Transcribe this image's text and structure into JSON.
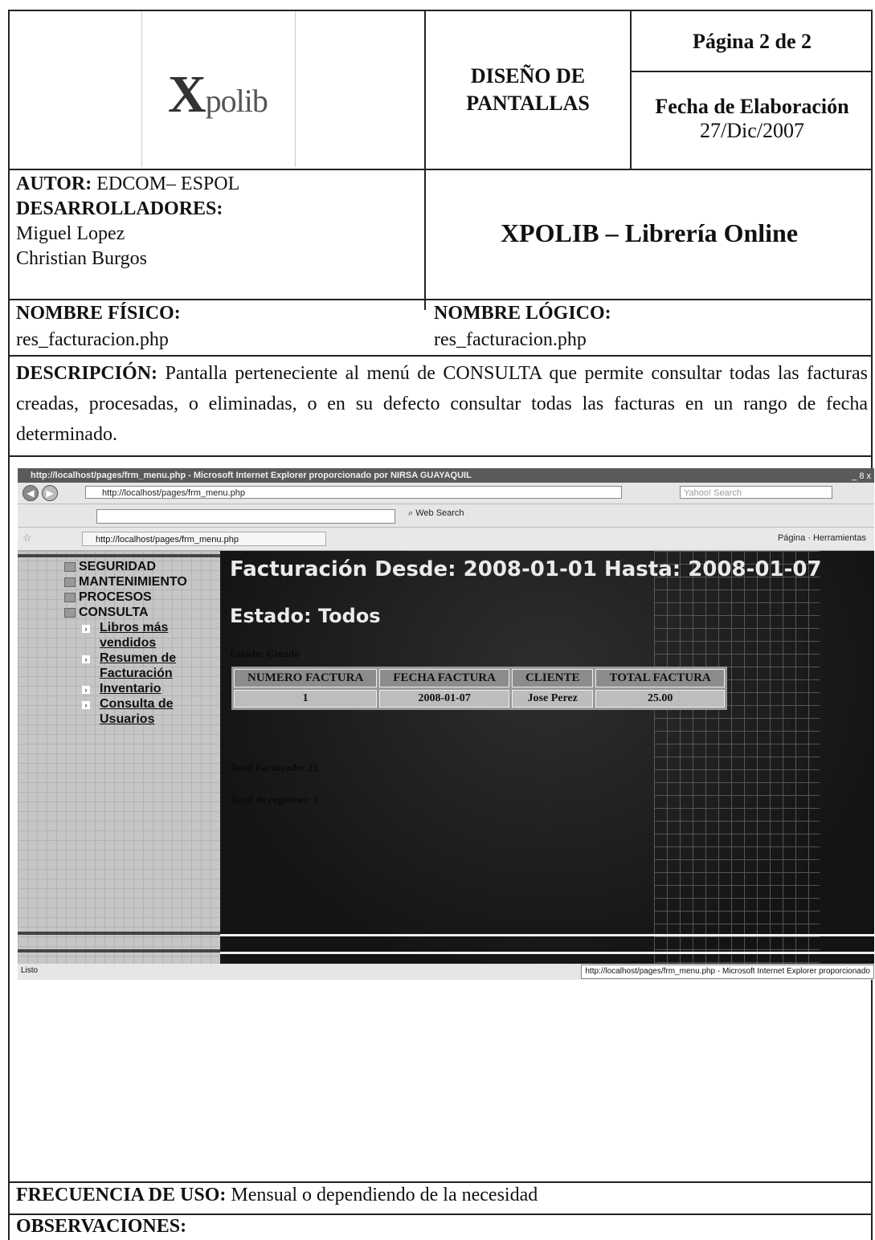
{
  "header": {
    "logo_text": "Xpolib",
    "doc_title_line1": "DISEÑO DE",
    "doc_title_line2": "PANTALLAS",
    "page_label": "Página 2 de 2",
    "date_label": "Fecha de Elaboración",
    "date_value": "27/Dic/2007"
  },
  "author": {
    "author_label": "AUTOR:",
    "author_value": " EDCOM– ESPOL",
    "devs_label": "DESARROLLADORES:",
    "dev1": "Miguel Lopez",
    "dev2": "Christian Burgos",
    "app_title": "XPOLIB – Librería Online"
  },
  "names": {
    "physical_label": "NOMBRE FÍSICO:",
    "physical_value": "res_facturacion.php",
    "logical_label": "NOMBRE LÓGICO:",
    "logical_value": "res_facturacion.php"
  },
  "description": {
    "label": "DESCRIPCIÓN:",
    "text": " Pantalla perteneciente al menú de CONSULTA que permite consultar todas las facturas creadas, procesadas, o eliminadas, o en su defecto consultar todas las facturas en un rango de fecha determinado."
  },
  "browser": {
    "window_title": "http://localhost/pages/frm_menu.php - Microsoft Internet Explorer proporcionado por NIRSA GUAYAQUIL",
    "window_buttons": "_ 8 x",
    "address": "http://localhost/pages/frm_menu.php",
    "search_placeholder": "Yahoo! Search",
    "web_search": "Web Search",
    "tab_label": "http://localhost/pages/frm_menu.php",
    "tools": "Página  ·  Herramientas",
    "status_left": "Listo",
    "status_right": "http://localhost/pages/frm_menu.php - Microsoft Internet Explorer proporcionado"
  },
  "menu": {
    "items": [
      "SEGURIDAD",
      "MANTENIMIENTO",
      "PROCESOS",
      "CONSULTA"
    ],
    "sub1_l1": "Libros más",
    "sub1_l2": "vendidos",
    "sub2_l1": "Resumen de",
    "sub2_l2": "Facturación",
    "sub3": "Inventario",
    "sub4_l1": "Consulta de",
    "sub4_l2": "Usuarios"
  },
  "report": {
    "heading": "Facturación Desde: 2008-01-01 Hasta: 2008-01-07",
    "state_heading": "Estado: Todos",
    "state_sub": "Estado: Creado",
    "columns": [
      "NUMERO FACTURA",
      "FECHA FACTURA",
      "CLIENTE",
      "TOTAL FACTURA"
    ],
    "rows": [
      [
        "1",
        "2008-01-07",
        "Jose Perez",
        "25.00"
      ]
    ],
    "total_facturado": "Total Facturado: 25",
    "total_registros": "Total de registros: 1"
  },
  "footer": {
    "freq_label": "FRECUENCIA DE USO:",
    "freq_value": " Mensual o dependiendo de la necesidad",
    "obs_label": "OBSERVACIONES:"
  }
}
